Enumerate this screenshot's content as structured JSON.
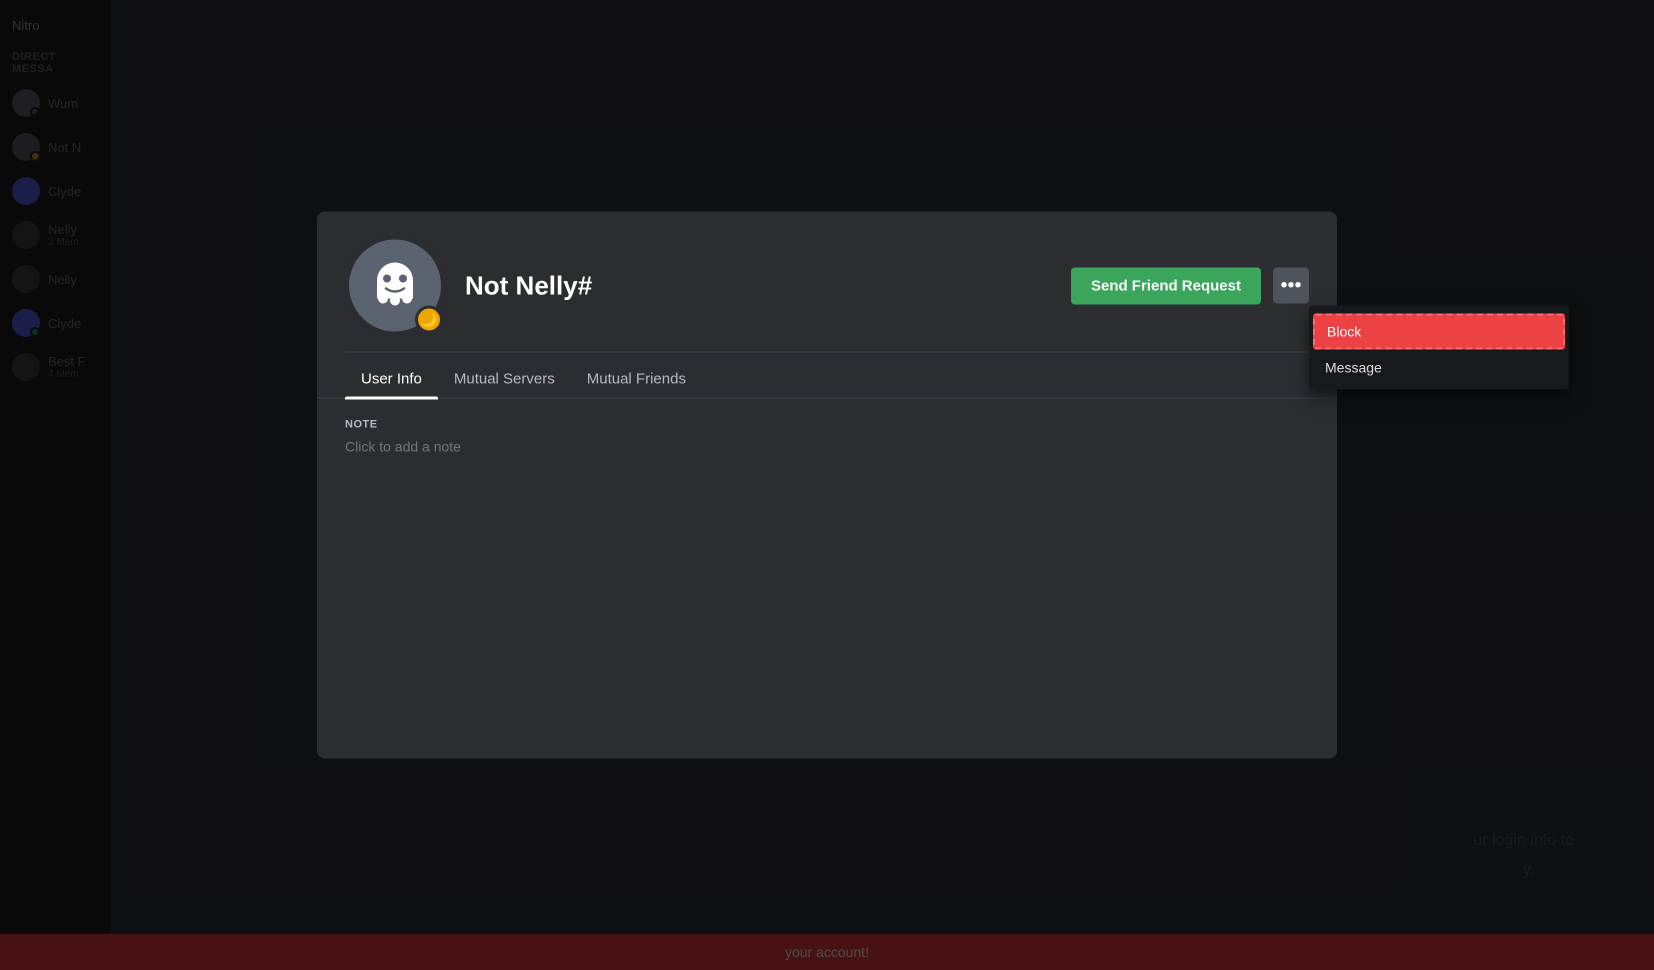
{
  "sidebar": {
    "nitro_label": "Nitro",
    "dm_label": "DIRECT MESSA",
    "items": [
      {
        "name": "Wum",
        "has_avatar": true,
        "status": "none"
      },
      {
        "name": "Not N",
        "has_avatar": true,
        "status": "moon"
      },
      {
        "name": "Clyde",
        "has_avatar": true,
        "status": "none"
      },
      {
        "name": "Nelly",
        "sub": "3 Mem",
        "has_avatar": true,
        "status": "none"
      },
      {
        "name": "Nelly",
        "has_avatar": true,
        "status": "none"
      },
      {
        "name": "Clyde",
        "has_avatar": true,
        "status": "green"
      },
      {
        "name": "Best F",
        "sub": "4 Mem",
        "has_avatar": true,
        "status": "none"
      }
    ]
  },
  "profile": {
    "username": "Not Nelly",
    "discriminator": "#",
    "avatar_bg": "#5c6370",
    "badge_emoji": "🌙",
    "send_friend_request_label": "Send Friend Request",
    "more_options_label": "•••",
    "tabs": [
      {
        "id": "user-info",
        "label": "User Info",
        "active": true
      },
      {
        "id": "mutual-servers",
        "label": "Mutual Servers",
        "active": false
      },
      {
        "id": "mutual-friends",
        "label": "Mutual Friends",
        "active": false
      }
    ],
    "note_section": {
      "label": "NOTE",
      "placeholder": "Click to add a note"
    }
  },
  "dropdown": {
    "items": [
      {
        "id": "block",
        "label": "Block",
        "style": "block"
      },
      {
        "id": "message",
        "label": "Message",
        "style": "normal"
      }
    ]
  },
  "notification_bar": {
    "text": "your account!"
  },
  "colors": {
    "send_friend_btn": "#3ba55c",
    "block_btn": "#ed4245",
    "modal_bg": "#2b2d31",
    "tab_active_underline": "#ffffff"
  }
}
